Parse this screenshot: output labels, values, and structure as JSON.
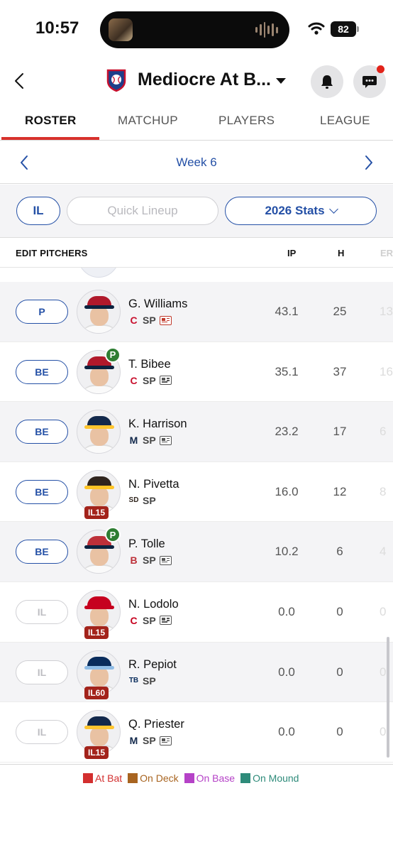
{
  "status_bar": {
    "time": "10:57",
    "battery": "82"
  },
  "header": {
    "team_name": "Mediocre At B..."
  },
  "tabs": [
    {
      "label": "ROSTER",
      "active": true
    },
    {
      "label": "MATCHUP",
      "active": false
    },
    {
      "label": "PLAYERS",
      "active": false
    },
    {
      "label": "LEAGUE",
      "active": false
    }
  ],
  "week_nav": {
    "label": "Week 6"
  },
  "filters": {
    "il_label": "IL",
    "quick_lineup_label": "Quick Lineup",
    "stats_label": "2026 Stats"
  },
  "table": {
    "title": "EDIT PITCHERS",
    "col_ip": "IP",
    "col_h": "H",
    "col_er": "ER"
  },
  "players": [
    {
      "slot": "P",
      "slot_active": true,
      "name": "G. Williams",
      "team_mark": "C",
      "team_color": "#c8102e",
      "pos": "SP",
      "news": "alert",
      "status": "",
      "il": "",
      "ip": "43.1",
      "h": "25",
      "er": "13",
      "cap": "#b0192b",
      "bill": "#0c2340"
    },
    {
      "slot": "BE",
      "slot_active": true,
      "name": "T. Bibee",
      "team_mark": "C",
      "team_color": "#c8102e",
      "pos": "SP",
      "news": "normal",
      "status": "P",
      "il": "",
      "ip": "35.1",
      "h": "37",
      "er": "16",
      "cap": "#b0192b",
      "bill": "#0c2340"
    },
    {
      "slot": "BE",
      "slot_active": true,
      "name": "K. Harrison",
      "team_mark": "M",
      "team_color": "#12284b",
      "pos": "SP",
      "news": "normal",
      "status": "",
      "il": "",
      "ip": "23.2",
      "h": "17",
      "er": "6",
      "cap": "#12284b",
      "bill": "#ffc52f"
    },
    {
      "slot": "BE",
      "slot_active": true,
      "name": "N. Pivetta",
      "team_mark": "SD",
      "team_color": "#2f241d",
      "pos": "SP",
      "news": "none",
      "status": "",
      "il": "IL15",
      "ip": "16.0",
      "h": "12",
      "er": "8",
      "cap": "#2f241d",
      "bill": "#ffc425"
    },
    {
      "slot": "BE",
      "slot_active": true,
      "name": "P. Tolle",
      "team_mark": "B",
      "team_color": "#bd3039",
      "pos": "SP",
      "news": "normal",
      "status": "P",
      "il": "",
      "ip": "10.2",
      "h": "6",
      "er": "4",
      "cap": "#bd3039",
      "bill": "#0c2340"
    },
    {
      "slot": "IL",
      "slot_active": false,
      "name": "N. Lodolo",
      "team_mark": "C",
      "team_color": "#c6011f",
      "pos": "SP",
      "news": "normal",
      "status": "",
      "il": "IL15",
      "ip": "0.0",
      "h": "0",
      "er": "0",
      "cap": "#c6011f",
      "bill": "#c6011f"
    },
    {
      "slot": "IL",
      "slot_active": false,
      "name": "R. Pepiot",
      "team_mark": "TB",
      "team_color": "#092c5c",
      "pos": "SP",
      "news": "none",
      "status": "",
      "il": "IL60",
      "ip": "0.0",
      "h": "0",
      "er": "0",
      "cap": "#092c5c",
      "bill": "#8fbce6"
    },
    {
      "slot": "IL",
      "slot_active": false,
      "name": "Q. Priester",
      "team_mark": "M",
      "team_color": "#12284b",
      "pos": "SP",
      "news": "normal",
      "status": "",
      "il": "IL15",
      "ip": "0.0",
      "h": "0",
      "er": "0",
      "cap": "#12284b",
      "bill": "#ffc52f"
    }
  ],
  "legend": [
    {
      "label": "At Bat",
      "color": "#d32f2f"
    },
    {
      "label": "On Deck",
      "color": "#a86420"
    },
    {
      "label": "On Base",
      "color": "#b542c7"
    },
    {
      "label": "On Mound",
      "color": "#2e8b7a"
    }
  ],
  "colors": {
    "accent": "#2450a6",
    "tab_underline": "#d8312c",
    "notification": "#e2231a"
  }
}
